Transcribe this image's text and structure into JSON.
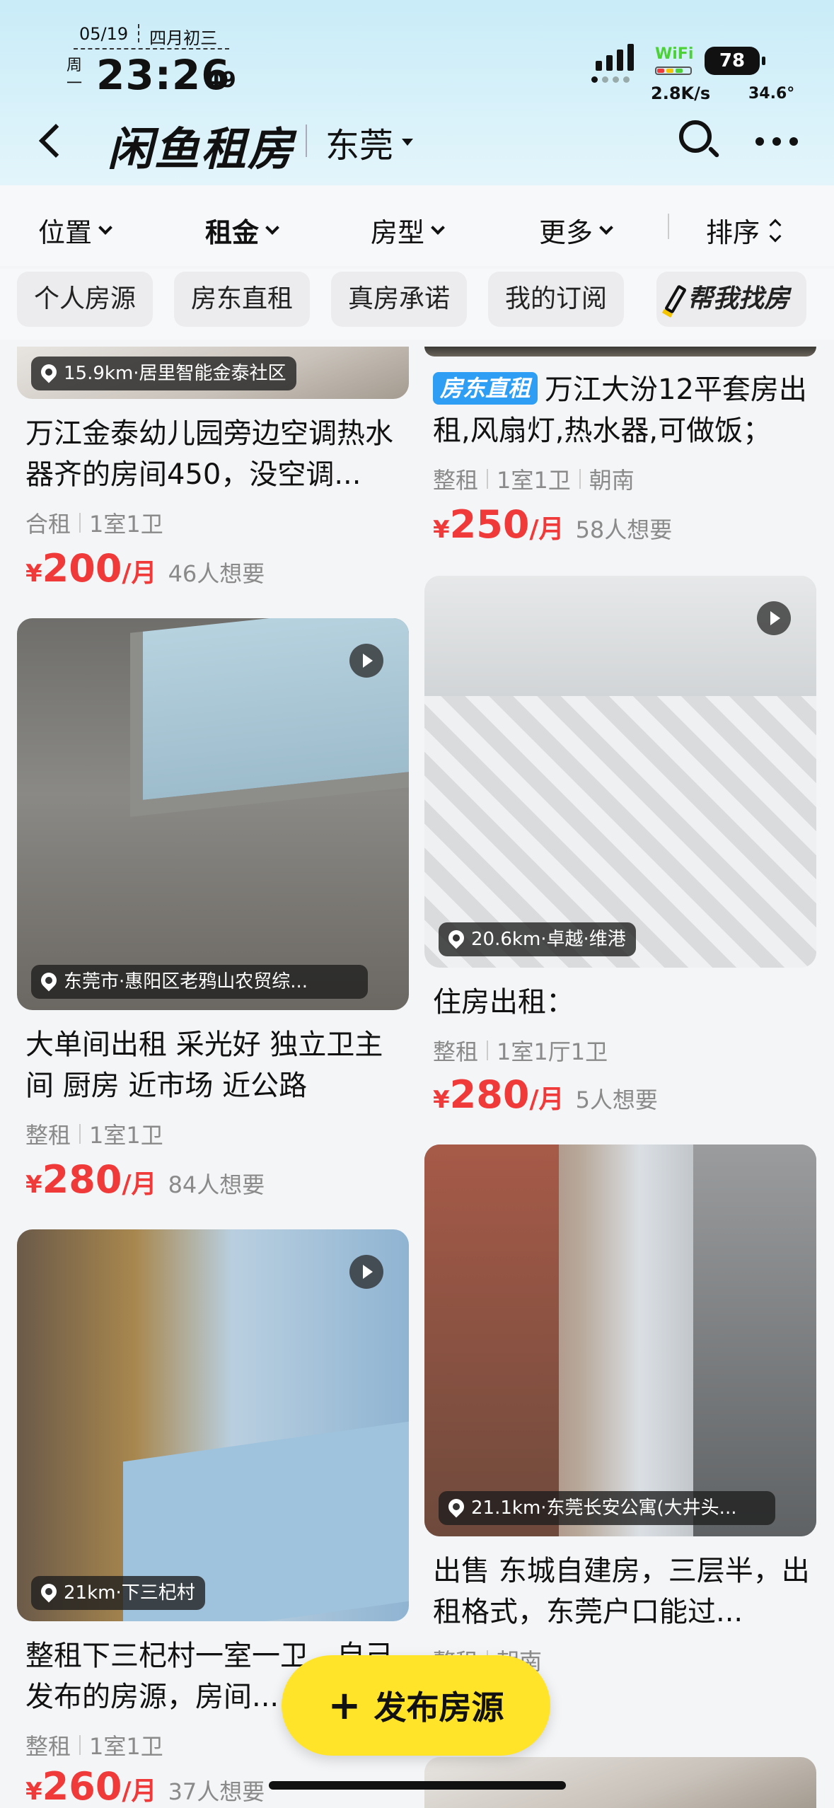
{
  "status_bar": {
    "date": "05/19",
    "lunar": "四月初三",
    "weekday": "周一",
    "time": "23:26",
    "seconds": "49",
    "wifi_label": "WiFi",
    "speed": "2.8K/s",
    "battery": "78",
    "temperature": "34.6°"
  },
  "nav": {
    "title": "闲鱼租房",
    "city": "东莞"
  },
  "filters": [
    "位置",
    "租金",
    "房型",
    "更多",
    "排序"
  ],
  "chips": [
    "个人房源",
    "房东直租",
    "真房承诺",
    "我的订阅",
    "帮我找房"
  ],
  "left_column": [
    {
      "location": "15.9km·居里智能金泰社区",
      "title": "万江金泰幼儿园旁边空调热水器齐的房间450，没空调...",
      "type": "合租",
      "rooms": "1室1卫",
      "price": "200",
      "want": "46人想要"
    },
    {
      "location": "东莞市·惠阳区老鸦山农贸综...",
      "title": "大单间出租 采光好 独立卫主间 厨房 近市场 近公路",
      "type": "整租",
      "rooms": "1室1卫",
      "price": "280",
      "want": "84人想要"
    },
    {
      "location": "21km·下三杞村",
      "title": "整租下三杞村一室一卫，自己发布的房源，房间...",
      "type": "整租",
      "rooms": "1室1卫",
      "price": "260",
      "want": "37人想要"
    }
  ],
  "right_column": [
    {
      "tag": "房东直租",
      "title": "万江大汾12平套房出租,风扇灯,热水器,可做饭；",
      "type": "整租",
      "rooms": "1室1卫",
      "orientation": "朝南",
      "price": "250",
      "want": "58人想要"
    },
    {
      "location": "20.6km·卓越·维港",
      "title": "住房出租：",
      "type": "整租",
      "rooms": "1室1厅1卫",
      "price": "280",
      "want": "5人想要"
    },
    {
      "location": "21.1km·东莞长安公寓(大井头...",
      "title": "出售 东城自建房，三层半，出租格式，东莞户口能过...",
      "type": "整租",
      "orientation": "朝南"
    }
  ],
  "price_symbol": "¥",
  "price_unit": "/月",
  "publish_label": "发布房源",
  "colors": {
    "accent_red": "#f03a3a",
    "publish_yellow": "#ffe42a",
    "tag_blue": "#2e9ef5",
    "header_bg": "#c9ecf8"
  },
  "icons": [
    "back-icon",
    "search-icon",
    "more-icon",
    "location-pin-icon",
    "play-icon",
    "pen-icon",
    "plus-icon"
  ]
}
